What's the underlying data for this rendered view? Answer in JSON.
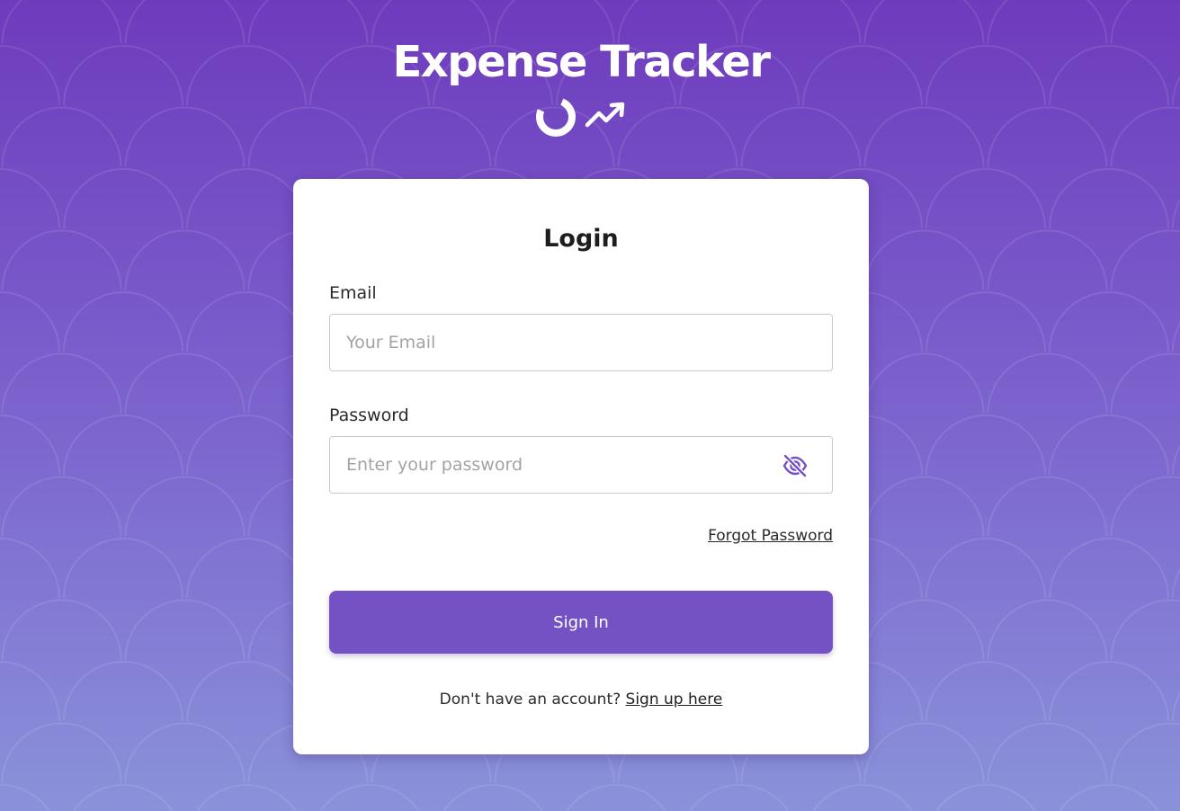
{
  "app": {
    "title": "Expense Tracker",
    "logo_icons": [
      "donut-chart-icon",
      "trending-up-icon"
    ]
  },
  "login": {
    "title": "Login",
    "email_label": "Email",
    "email_placeholder": "Your Email",
    "email_value": "",
    "password_label": "Password",
    "password_placeholder": "Enter your password",
    "password_value": "",
    "password_toggle_icon": "eye-off-icon",
    "forgot_password": "Forgot Password",
    "sign_in_label": "Sign In",
    "signup_prompt": "Don't have an account?",
    "signup_link": "Sign up here"
  },
  "colors": {
    "background_top": "#6e3bbd",
    "background_bottom": "#8a92da",
    "accent": "#7452c4",
    "card": "#ffffff",
    "text": "#1d1d1f"
  }
}
